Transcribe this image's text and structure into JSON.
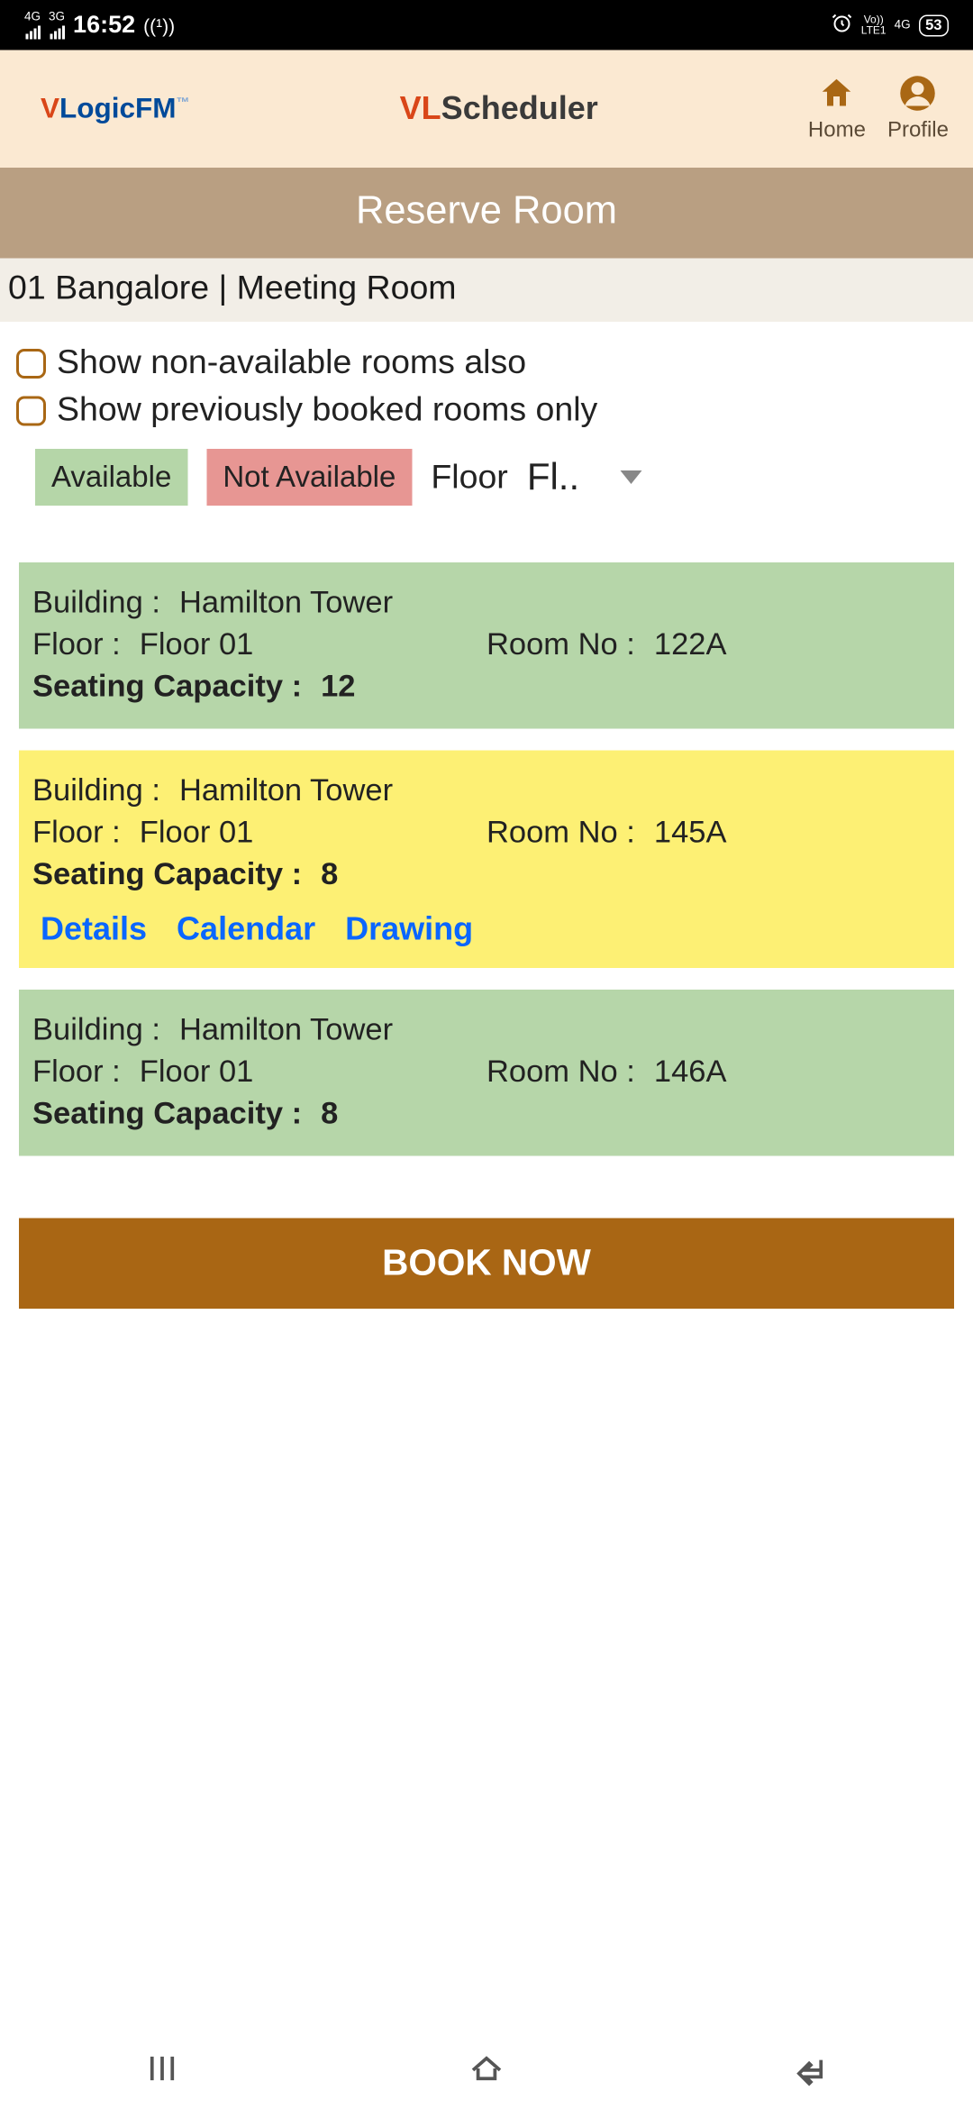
{
  "status": {
    "net1": "4G",
    "net2": "3G",
    "time": "16:52",
    "volte_top": "Vo))",
    "volte_bot": "LTE1",
    "net3": "4G",
    "battery": "53"
  },
  "header": {
    "logo1_v": "V",
    "logo1_rest": "LogicFM",
    "logo1_tm": "™",
    "logo2_vl": "VL",
    "logo2_rest": "Scheduler",
    "nav_home": "Home",
    "nav_profile": "Profile"
  },
  "title": "Reserve Room",
  "breadcrumb": "01 Bangalore | Meeting Room",
  "filters": {
    "chk1": "Show non-available rooms also",
    "chk2": "Show previously booked rooms only",
    "avail": "Available",
    "not_avail": "Not Available",
    "floor_label": "Floor",
    "floor_value": "Fl.."
  },
  "labels": {
    "building": "Building :",
    "floor": "Floor :",
    "room": "Room No :",
    "seating": "Seating Capacity :"
  },
  "rooms": [
    {
      "building": "Hamilton Tower",
      "floor": "Floor 01",
      "room": "122A",
      "capacity": "12",
      "status": "green",
      "expanded": false
    },
    {
      "building": "Hamilton Tower",
      "floor": "Floor 01",
      "room": "145A",
      "capacity": "8",
      "status": "yellow",
      "expanded": true
    },
    {
      "building": "Hamilton Tower",
      "floor": "Floor 01",
      "room": "146A",
      "capacity": "8",
      "status": "green",
      "expanded": false
    }
  ],
  "links": {
    "details": "Details",
    "calendar": "Calendar",
    "drawing": "Drawing"
  },
  "book": "BOOK NOW"
}
